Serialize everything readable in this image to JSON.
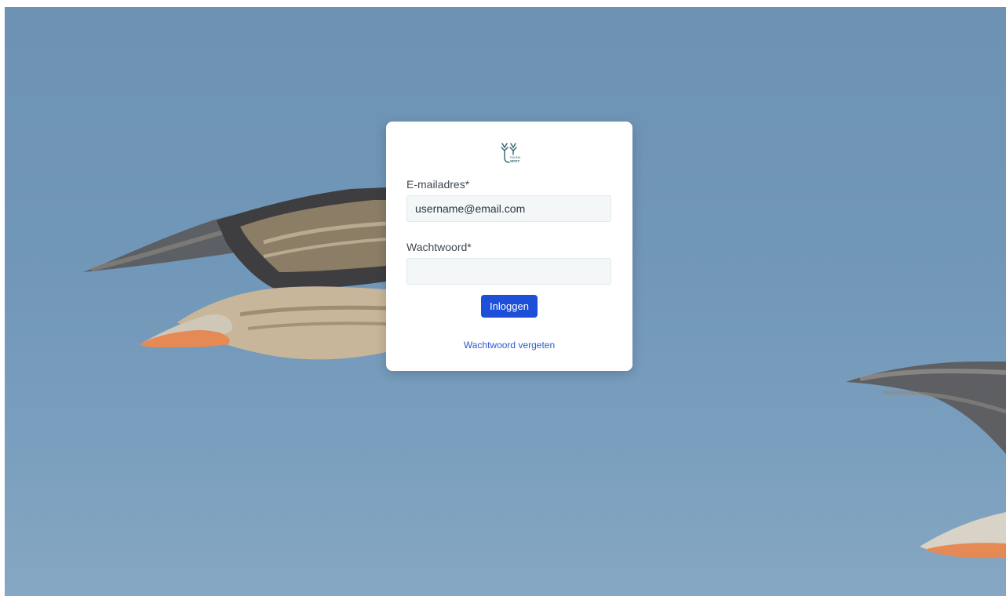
{
  "brand": {
    "logo_icon": "faunaspot-logo-icon",
    "logo_text_top": "FAUNA",
    "logo_text_bottom": "SPOT",
    "logo_color": "#2f6470"
  },
  "login_form": {
    "email_label": "E-mailadres*",
    "email_value": "username@email.com",
    "email_placeholder": "",
    "password_label": "Wachtwoord*",
    "password_value": "",
    "submit_label": "Inloggen",
    "forgot_password_label": "Wachtwoord vergeten"
  },
  "colors": {
    "primary_button": "#1d4fd8",
    "link": "#2a5bc9",
    "sky": "#7096b8"
  }
}
